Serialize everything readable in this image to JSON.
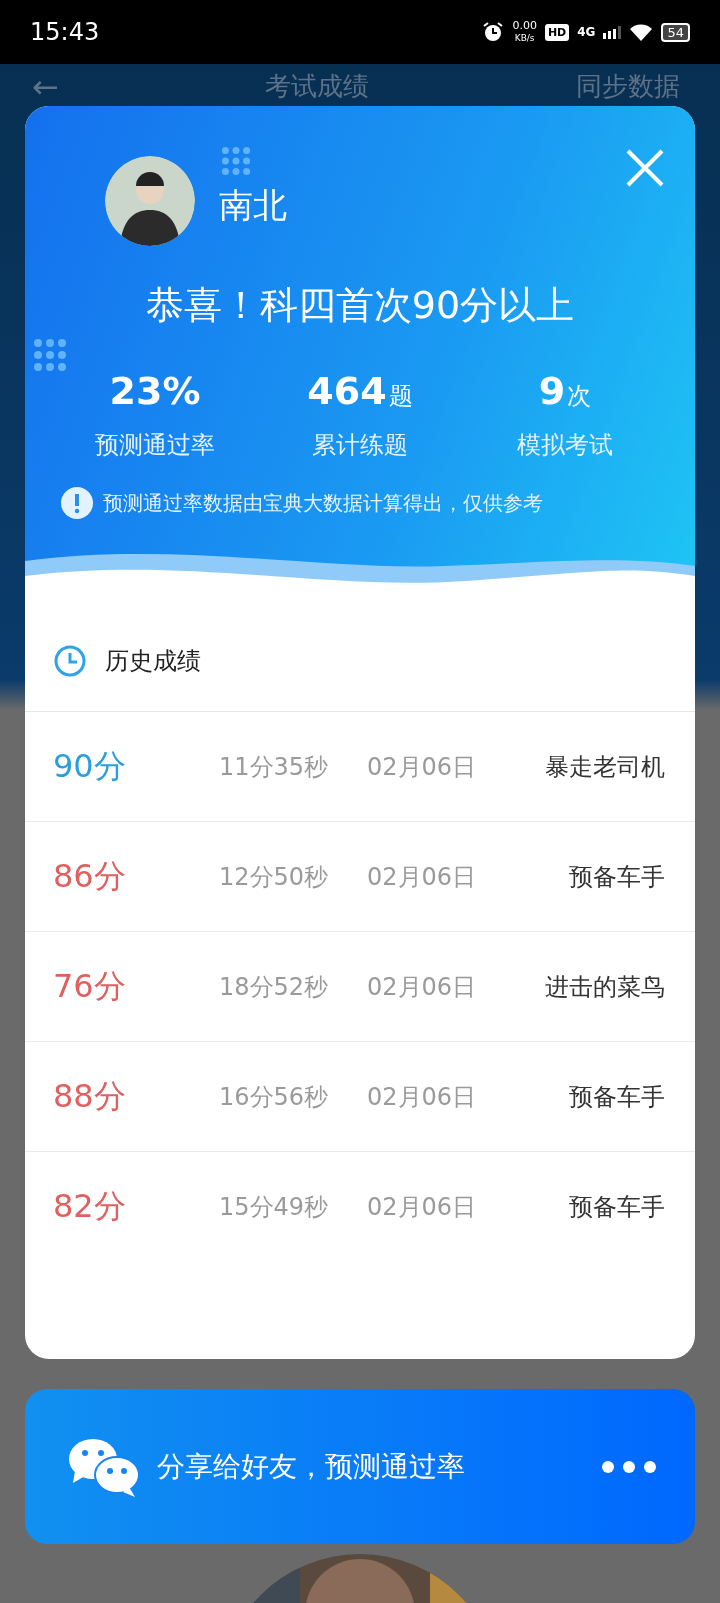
{
  "status_bar": {
    "time": "15:43",
    "net_speed": "0.00",
    "net_unit": "KB/s",
    "hd": "HD",
    "network": "4G",
    "battery": "54"
  },
  "app_header": {
    "back": "←",
    "title": "考试成绩",
    "action": "同步数据"
  },
  "result_card": {
    "user_name": "南北",
    "headline": "恭喜！科四首次90分以上",
    "stats": [
      {
        "value": "23%",
        "label": "预测通过率"
      },
      {
        "value": "464",
        "unit": "题",
        "label": "累计练题"
      },
      {
        "value": "9",
        "unit": "次",
        "label": "模拟考试"
      }
    ],
    "notice": "预测通过率数据由宝典大数据计算得出，仅供参考",
    "history_title": "历史成绩",
    "history": [
      {
        "score": "90分",
        "passed": true,
        "duration": "11分35秒",
        "date": "02月06日",
        "rank": "暴走老司机"
      },
      {
        "score": "86分",
        "passed": false,
        "duration": "12分50秒",
        "date": "02月06日",
        "rank": "预备车手"
      },
      {
        "score": "76分",
        "passed": false,
        "duration": "18分52秒",
        "date": "02月06日",
        "rank": "进击的菜鸟"
      },
      {
        "score": "88分",
        "passed": false,
        "duration": "16分56秒",
        "date": "02月06日",
        "rank": "预备车手"
      },
      {
        "score": "82分",
        "passed": false,
        "duration": "15分49秒",
        "date": "02月06日",
        "rank": "预备车手"
      }
    ]
  },
  "share_bar": {
    "label": "分享给好友，预测通过率"
  }
}
